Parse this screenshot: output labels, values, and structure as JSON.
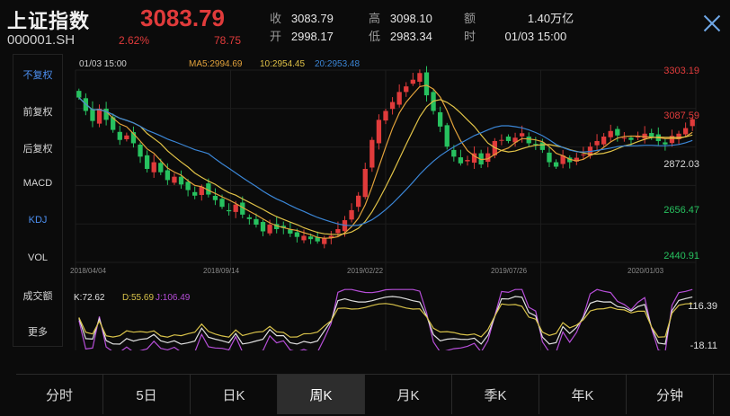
{
  "header": {
    "name": "上证指数",
    "code": "000001.SH",
    "price": "3083.79",
    "pct": "2.62%",
    "change": "78.75",
    "stats": [
      {
        "label": "收",
        "value": "3083.79"
      },
      {
        "label": "高",
        "value": "3098.10"
      },
      {
        "label": "额",
        "value": "1.40万亿"
      },
      {
        "label": "开",
        "value": "2998.17"
      },
      {
        "label": "低",
        "value": "2983.34"
      },
      {
        "label": "时",
        "value": "01/03 15:00"
      }
    ]
  },
  "sidebar": {
    "items": [
      {
        "label": "不复权",
        "active": true
      },
      {
        "label": "前复权",
        "active": false
      },
      {
        "label": "后复权",
        "active": false
      },
      {
        "label": "MACD",
        "active": false
      },
      {
        "label": "KDJ",
        "active": true
      },
      {
        "label": "VOL",
        "active": false
      },
      {
        "label": "成交额",
        "active": false
      },
      {
        "label": "更多",
        "active": false
      }
    ]
  },
  "main_chart": {
    "time": "01/03 15:00",
    "ma_label": "MA5:2994.69",
    "ma10_label": "10:2954.45",
    "ma20_label": "20:2953.48",
    "y_ticks": [
      "3303.19",
      "3087.59",
      "2872.03",
      "2656.47",
      "2440.91"
    ],
    "x_ticks": [
      "2018/04/04",
      "2018/09/14",
      "2019/02/22",
      "2019/07/26",
      "2020/01/03"
    ]
  },
  "kdj": {
    "k_label": "K:72.62",
    "d_label": "D:55.69",
    "j_label": "J:106.49",
    "y_ticks": [
      "116.39",
      "-18.11"
    ]
  },
  "tabs": [
    {
      "label": "分时",
      "active": false
    },
    {
      "label": "5日",
      "active": false
    },
    {
      "label": "日K",
      "active": false
    },
    {
      "label": "周K",
      "active": true
    },
    {
      "label": "月K",
      "active": false
    },
    {
      "label": "季K",
      "active": false
    },
    {
      "label": "年K",
      "active": false
    },
    {
      "label": "分钟",
      "active": false
    }
  ],
  "colors": {
    "up": "#e03b3b",
    "down": "#27c15f",
    "ma5": "#e2a23b",
    "ma10": "#e0c247",
    "ma20": "#3b86d6",
    "k": "#e0e0e0",
    "d": "#d8c24a",
    "j": "#b64ed8",
    "active": "#4c8ff0"
  },
  "chart_data": {
    "type": "candlestick",
    "y_range": [
      2440.91,
      3303.19
    ],
    "close_series": [
      3180,
      3120,
      3075,
      3130,
      3080,
      3035,
      2990,
      3010,
      2975,
      2915,
      2860,
      2890,
      2845,
      2810,
      2825,
      2790,
      2765,
      2740,
      2780,
      2745,
      2720,
      2690,
      2670,
      2700,
      2655,
      2635,
      2610,
      2580,
      2610,
      2590,
      2595,
      2570,
      2555,
      2560,
      2545,
      2535,
      2550,
      2560,
      2590,
      2630,
      2675,
      2740,
      2860,
      2990,
      3080,
      3120,
      3160,
      3205,
      3230,
      3260,
      3290,
      3190,
      3120,
      3050,
      2960,
      2915,
      2885,
      2900,
      2930,
      2880,
      2930,
      2985,
      2990,
      2985,
      3000,
      3020,
      2975,
      2970,
      2945,
      2890,
      2870,
      2920,
      2890,
      2910,
      2925,
      2960,
      2985,
      3005,
      3030,
      3010,
      3000,
      2990,
      3005,
      3018,
      3000,
      2985,
      2970,
      3008,
      3018,
      3043,
      3083
    ]
  }
}
